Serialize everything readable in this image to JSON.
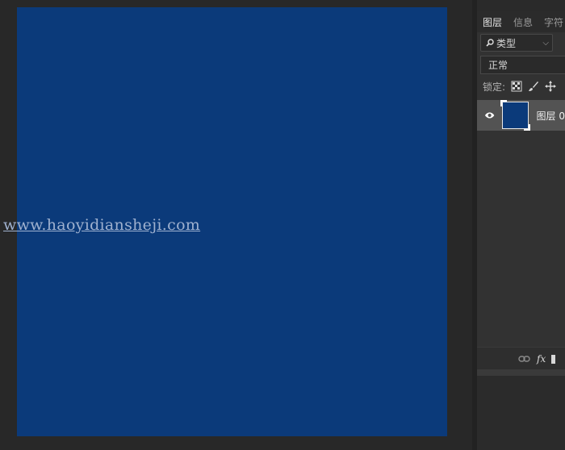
{
  "watermark": "www.haoyidiansheji.com",
  "canvas": {
    "fill_color": "#0b3a7a"
  },
  "layers_panel": {
    "tabs": [
      "图层",
      "信息",
      "字符"
    ],
    "active_tab": "图层",
    "filter": {
      "label": "类型",
      "icon": "search-icon"
    },
    "blend_mode": "正常",
    "lock_label": "锁定:",
    "lock_icons": [
      "lock-transparency-icon",
      "lock-pixels-icon",
      "lock-position-icon"
    ],
    "layers": [
      {
        "name": "图层 0",
        "visible": true,
        "thumbnail_color": "#0b3a7a"
      }
    ],
    "footer_icons": [
      "link-icon",
      "fx-icon",
      "new-layer-icon"
    ],
    "fx_label": "fx"
  }
}
